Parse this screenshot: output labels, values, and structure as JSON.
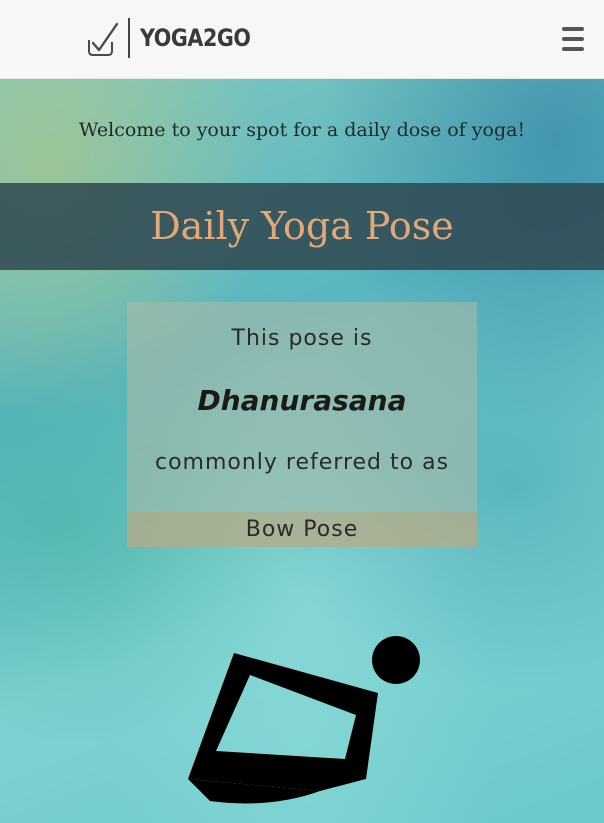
{
  "header": {
    "brand": "YOGA2GO",
    "icons": {
      "logo": "checkmark-logo-icon",
      "menu": "hamburger-menu-icon"
    }
  },
  "hero": {
    "welcome": "Welcome to your spot for a daily dose of yoga!",
    "section_title": "Daily Yoga Pose",
    "pose": {
      "intro": "This pose is",
      "sanskrit_name": "Dhanurasana",
      "connector": "commonly referred to as",
      "english_name": "Bow Pose",
      "figure_icon": "bow-pose-figure-icon"
    }
  },
  "colors": {
    "title_accent": "#e2a776",
    "band": "#2f4852",
    "teal_background": "#6cc8cc",
    "header_bg": "#f7f7f7"
  }
}
